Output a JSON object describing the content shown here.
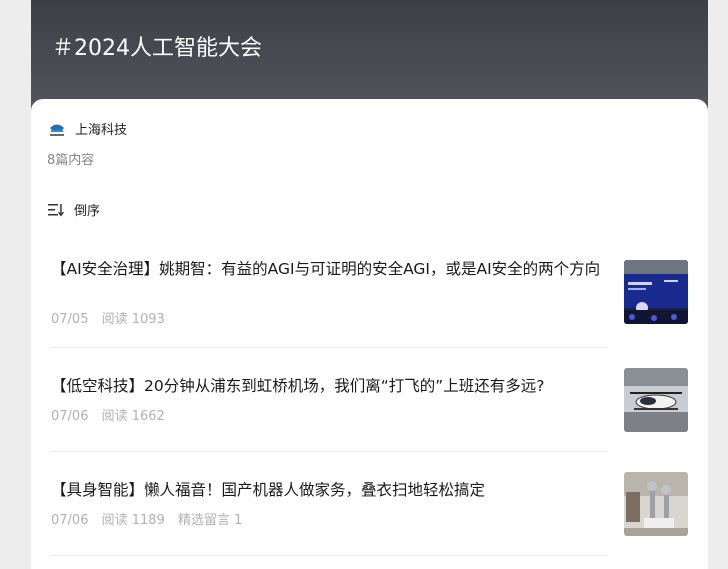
{
  "topic": {
    "title": "＃2024人工智能大会"
  },
  "account": {
    "name": "上海科技",
    "logo_text": "上海科技"
  },
  "count_text": "8篇内容",
  "sort": {
    "label": "倒序",
    "icon": "sort-descending-icon"
  },
  "articles": [
    {
      "title": "【AI安全治理】姚期智：有益的AGI与可证明的安全AGI，或是AI安全的两个方向",
      "date": "07/05",
      "reads": "阅读 1093",
      "comments": "",
      "thumb": "conference-stage-photo"
    },
    {
      "title": "【低空科技】20分钟从浦东到虹桥机场，我们离“打飞的”上班还有多远?",
      "date": "07/06",
      "reads": "阅读 1662",
      "comments": "",
      "thumb": "evtol-aircraft-photo"
    },
    {
      "title": "【具身智能】懒人福音！国产机器人做家务，叠衣扫地轻松搞定",
      "date": "07/06",
      "reads": "阅读 1189",
      "comments": "精选留言 1",
      "thumb": "robot-arm-photo"
    }
  ],
  "colors": {
    "header_top": "#3d3f47",
    "header_bottom": "#55575f",
    "meta_text": "#b2b2b2",
    "background": "#ededed"
  }
}
